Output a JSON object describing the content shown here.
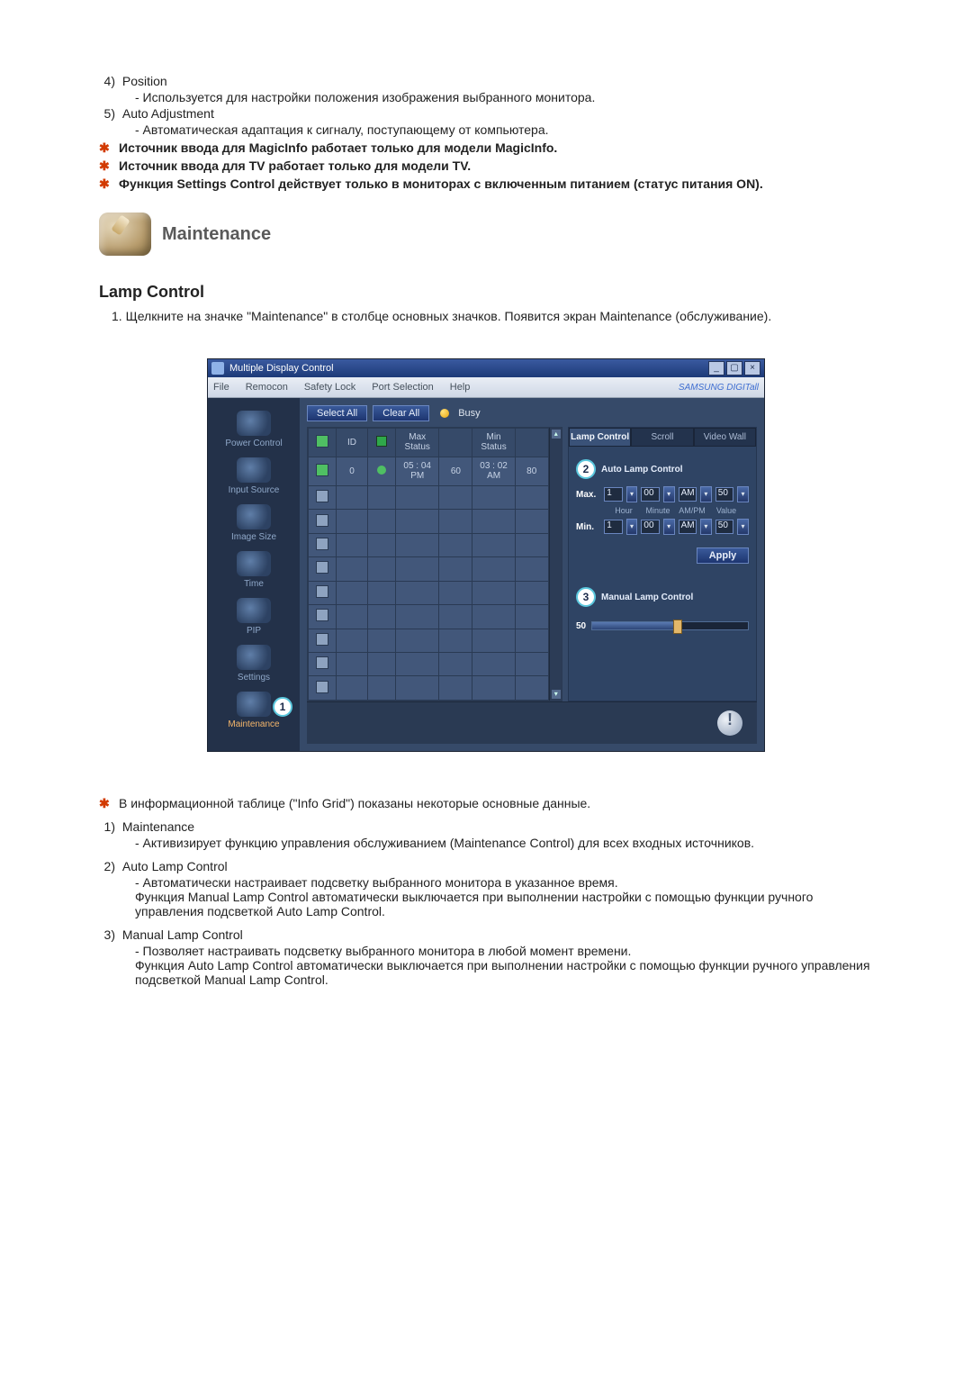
{
  "top_items": [
    {
      "num": "4)",
      "title": "Position",
      "desc": "- Используется для настройки положения изображения выбранного монитора."
    },
    {
      "num": "5)",
      "title": "Auto Adjustment",
      "desc": "- Автоматическая адаптация к сигналу, поступающему от компьютера."
    }
  ],
  "star_notes": [
    "Источник ввода для MagicInfo работает только для модели MagicInfo.",
    "Источник ввода для TV работает только для модели TV.",
    "Функция Settings Control действует только в мониторах с включенным питанием (статус питания ON)."
  ],
  "maintenance_heading": "Maintenance",
  "lamp_heading": "Lamp Control",
  "step1": "Щелкните на значке \"Maintenance\" в столбце основных значков. Появится экран Maintenance (обслуживание).",
  "app": {
    "title": "Multiple Display Control",
    "menus": [
      "File",
      "Remocon",
      "Safety Lock",
      "Port Selection",
      "Help"
    ],
    "brand": "SAMSUNG DIGITall",
    "sidebar": [
      {
        "label": "Power Control",
        "active": false
      },
      {
        "label": "Input Source",
        "active": false
      },
      {
        "label": "Image Size",
        "active": false
      },
      {
        "label": "Time",
        "active": false
      },
      {
        "label": "PIP",
        "active": false
      },
      {
        "label": "Settings",
        "active": false
      },
      {
        "label": "Maintenance",
        "active": true,
        "badge": "1"
      }
    ],
    "toolbar": {
      "select_all": "Select All",
      "clear_all": "Clear All",
      "busy": "Busy"
    },
    "grid": {
      "headers": {
        "id": "ID",
        "max_status": "Max Status",
        "max_val": "",
        "min_status": "Min Status",
        "min_val": ""
      },
      "rows": [
        {
          "checked": true,
          "id": "0",
          "status": "on",
          "max_status": "05 : 04 PM",
          "max_val": "60",
          "min_status": "03 : 02 AM",
          "min_val": "80"
        },
        {},
        {},
        {},
        {},
        {},
        {},
        {},
        {},
        {}
      ]
    },
    "right_panel": {
      "tabs": [
        "Lamp Control",
        "Scroll",
        "Video Wall"
      ],
      "auto_title": "Auto Lamp Control",
      "auto_badge": "2",
      "cols": [
        "Hour",
        "Minute",
        "AM/PM",
        "Value"
      ],
      "max_label": "Max.",
      "min_label": "Min.",
      "max_vals": {
        "hour": "1",
        "minute": "00",
        "ampm": "AM",
        "value": "50"
      },
      "min_vals": {
        "hour": "1",
        "minute": "00",
        "ampm": "AM",
        "value": "50"
      },
      "apply": "Apply",
      "manual_title": "Manual Lamp Control",
      "manual_badge": "3",
      "manual_value": "50"
    }
  },
  "after_star": "В информационной таблице (\"Info Grid\") показаны некоторые основные данные.",
  "bottom_items": [
    {
      "num": "1)",
      "title": "Maintenance",
      "desc": "- Активизирует функцию управления обслуживанием (Maintenance Control) для всех входных источников."
    },
    {
      "num": "2)",
      "title": "Auto Lamp Control",
      "desc": "- Автоматически настраивает подсветку выбранного монитора в указанное время.\nФункция Manual Lamp Control автоматически выключается при выполнении настройки с помощью функции ручного управления подсветкой Auto Lamp Control."
    },
    {
      "num": "3)",
      "title": "Manual Lamp Control",
      "desc": "- Позволяет настраивать подсветку выбранного монитора в любой момент времени.\nФункция Auto Lamp Control автоматически выключается при выполнении настройки с помощью функции ручного управления подсветкой Manual Lamp Control."
    }
  ]
}
